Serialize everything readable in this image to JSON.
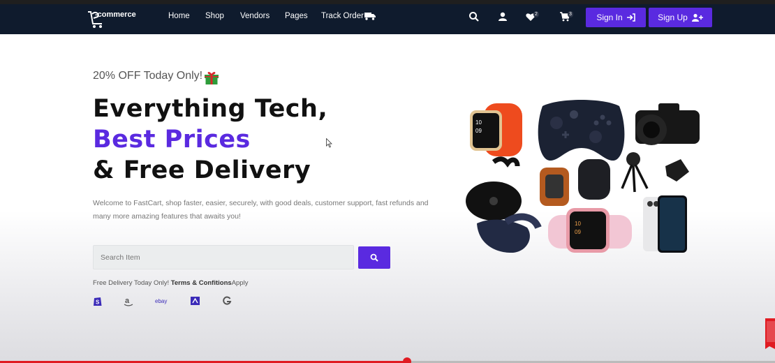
{
  "header": {
    "logo_text": "-commerce",
    "nav": [
      "Home",
      "Shop",
      "Vendors",
      "Pages",
      "Track Order"
    ],
    "wishlist_count": "2",
    "cart_count": "3",
    "signin_label": "Sign In",
    "signup_label": "Sign Up"
  },
  "hero": {
    "offer": "20% OFF Today Only!",
    "line1": "Everything Tech,",
    "line2": "Best Prices",
    "line3": "& Free Delivery",
    "description": "Welcome to FastCart, shop faster, easier, securely, with good deals, customer support, fast refunds and many more amazing features that awaits you!",
    "search_placeholder": "Search Item",
    "delivery_prefix": "Free Delivery Today Only! ",
    "delivery_terms": "Terms & Confitions",
    "delivery_suffix": "Apply",
    "partners": [
      "shopify-icon",
      "amazon-icon",
      "ebay-icon",
      "store-icon",
      "google-icon"
    ],
    "partner_ebay": "ebay"
  },
  "colors": {
    "accent": "#5a2ae0",
    "navbar": "#0f1b2d",
    "progress": "#e01b22"
  },
  "video": {
    "progress_fraction": 0.525
  }
}
